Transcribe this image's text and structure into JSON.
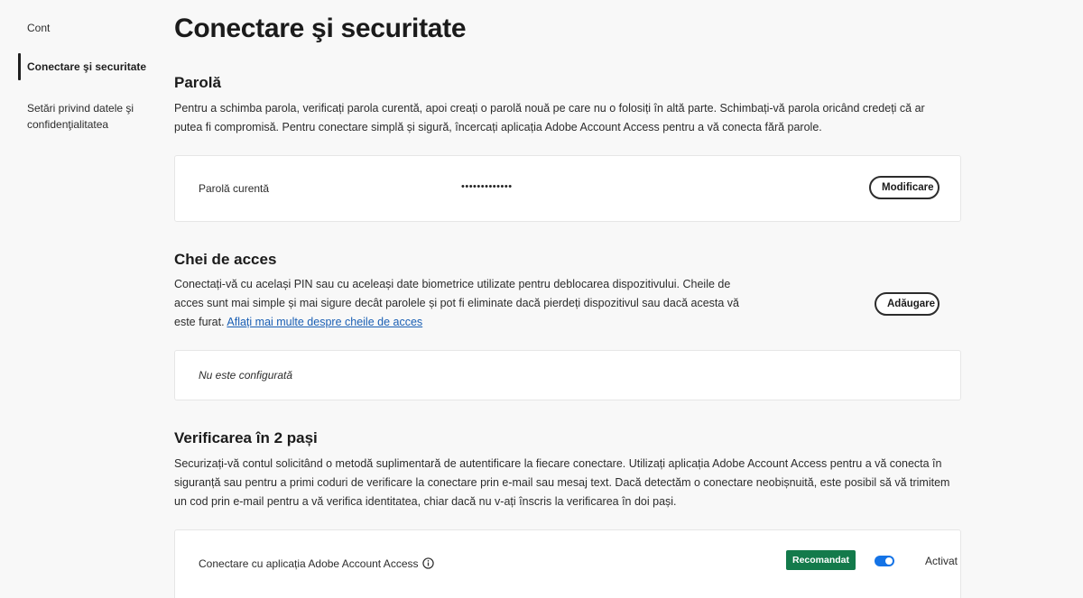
{
  "sidebar": {
    "items": [
      {
        "label": "Cont"
      },
      {
        "label": "Conectare şi securitate"
      },
      {
        "label": "Setări privind datele şi confidenţialitatea"
      }
    ]
  },
  "page": {
    "title": "Conectare şi securitate"
  },
  "password": {
    "title": "Parolă",
    "description": "Pentru a schimba parola, verificați parola curentă, apoi creați o parolă nouă pe care nu o folosiți în altă parte. Schimbați-vă parola oricând credeți că ar putea fi compromisă. Pentru conectare simplă și sigură, încercați aplicația Adobe Account Access pentru a vă conecta fără parole.",
    "current_label": "Parolă curentă",
    "masked_value": "•••••••••••••",
    "change_button": "Modificare"
  },
  "passkeys": {
    "title": "Chei de acces",
    "description": "Conectați-vă cu același PIN sau cu aceleași date biometrice utilizate pentru deblocarea dispozitivului. Cheile de acces sunt mai simple și mai sigure decât parolele și pot fi eliminate dacă pierdeți dispozitivul sau dacă acesta vă este furat.",
    "learn_more_link": "Aflați mai multe despre cheile de acces",
    "add_button": "Adăugare",
    "status": "Nu este configurată"
  },
  "two_step": {
    "title": "Verificarea în 2 pași",
    "description": "Securizați-vă contul solicitând o metodă suplimentară de autentificare la fiecare conectare. Utilizați aplicația Adobe Account Access pentru a vă conecta în siguranță sau pentru a primi coduri de verificare la conectare prin e-mail sau mesaj text. Dacă detectăm o conectare neobișnuită, este posibil să vă trimitem un cod prin e-mail pentru a vă verifica identitatea, chiar dacă nu v-ați înscris la verificarea în doi pași.",
    "app_label": "Conectare cu aplicația Adobe Account Access",
    "recommended_badge": "Recomandat",
    "toggle_state": "Activat",
    "toggle_on": true
  },
  "icons": {
    "info": "info-icon"
  },
  "colors": {
    "accent": "#1473e6",
    "link": "#1a5fb4",
    "badge": "#137a4b",
    "background": "#f8f8f8"
  }
}
